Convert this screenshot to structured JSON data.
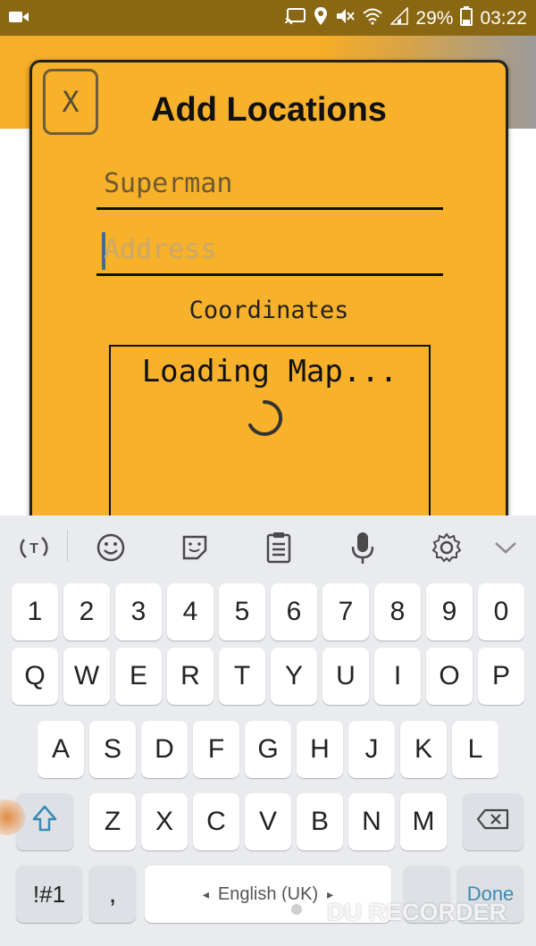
{
  "status_bar": {
    "battery_percent": "29%",
    "time": "03:22",
    "icons": [
      "video-record-icon",
      "cast-icon",
      "location-icon",
      "mute-icon",
      "wifi-icon",
      "signal-icon",
      "battery-icon"
    ]
  },
  "dialog": {
    "close_label": "X",
    "title": "Add Locations",
    "name_field": {
      "value": "Superman"
    },
    "address_field": {
      "placeholder": "Address",
      "value": ""
    },
    "coordinates_label": "Coordinates",
    "map": {
      "loading_text": "Loading Map..."
    }
  },
  "keyboard": {
    "toolbar_icons": [
      "text-translate-icon",
      "emoji-icon",
      "sticker-icon",
      "clipboard-icon",
      "microphone-icon",
      "settings-gear-icon",
      "chevron-down-icon"
    ],
    "row_numbers": [
      "1",
      "2",
      "3",
      "4",
      "5",
      "6",
      "7",
      "8",
      "9",
      "0"
    ],
    "row_1": [
      "Q",
      "W",
      "E",
      "R",
      "T",
      "Y",
      "U",
      "I",
      "O",
      "P"
    ],
    "row_2": [
      "A",
      "S",
      "D",
      "F",
      "G",
      "H",
      "J",
      "K",
      "L"
    ],
    "row_3": [
      "Z",
      "X",
      "C",
      "V",
      "B",
      "N",
      "M"
    ],
    "symbols_key": "!#1",
    "comma_key": ",",
    "space_label": "English (UK)",
    "done_key": "Done"
  },
  "watermark": {
    "text": "DU RECORDER"
  },
  "colors": {
    "dialog_bg": "#f7b12a",
    "status_bar_bg": "#8a6712",
    "keyboard_bg": "#e9ebee"
  }
}
